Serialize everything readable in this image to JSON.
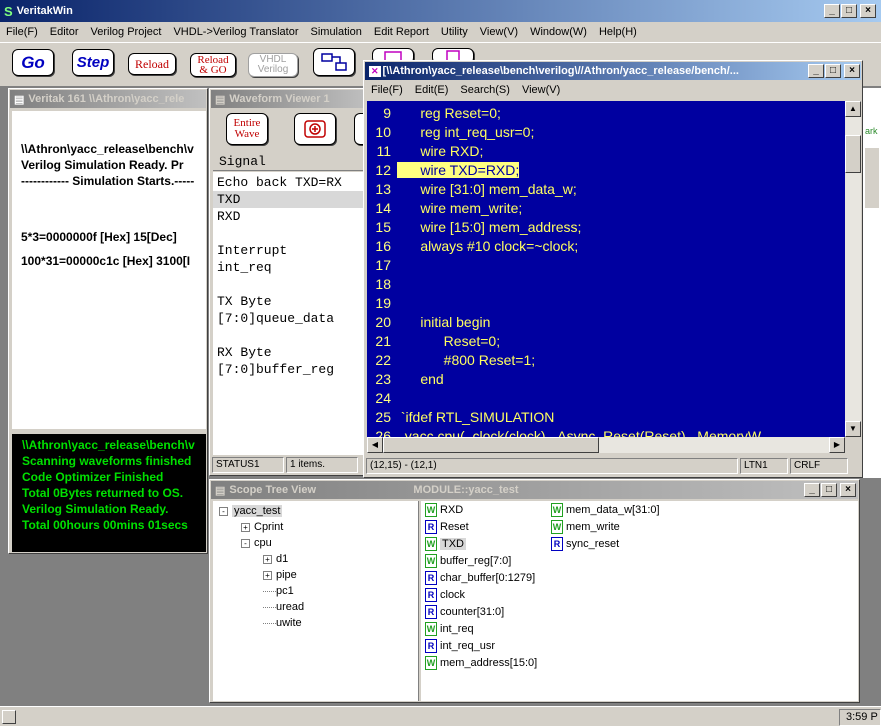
{
  "app": {
    "title": "VeritakWin"
  },
  "menu": [
    "File(F)",
    "Editor",
    "Verilog Project",
    "VHDL->Verilog Translator",
    "Simulation",
    "Edit Report",
    "Utility",
    "View(V)",
    "Window(W)",
    "Help(H)"
  ],
  "toolbar": {
    "go": "Go",
    "step": "Step",
    "reload": "Reload",
    "reload_go_1": "Reload",
    "reload_go_2": "& GO",
    "vhdl_1": "VHDL",
    "vhdl_2": "Verilog"
  },
  "console": {
    "title": "Veritak 161 \\\\Athron\\yacc_rele",
    "lines": [
      "\\\\Athron\\yacc_release\\bench\\v",
      "Verilog Simulation Ready. Pr",
      "------------ Simulation Starts.-----",
      "",
      "",
      "5*3=0000000f [Hex]    15[Dec]",
      "",
      "100*31=00000c1c [Hex]   3100[I"
    ],
    "green_lines": [
      "\\\\Athron\\yacc_release\\bench\\v",
      "Scanning waveforms finished",
      "Code Optimizer Finished",
      "Total 0Bytes returned to OS.",
      "Verilog Simulation Ready.",
      "Total  00hours 00mins 01secs"
    ]
  },
  "waveform": {
    "title": "Waveform Viewer 1",
    "entire_wave_1": "Entire",
    "entire_wave_2": "Wave",
    "signal_header": "Signal",
    "signals": [
      "Echo back TXD=RX",
      "TXD",
      "RXD",
      "",
      "Interrupt",
      "int_req",
      "",
      "TX Byte",
      "[7:0]queue_data",
      "",
      "RX Byte",
      "[7:0]buffer_reg"
    ],
    "status": [
      "STATUS1",
      "1 items."
    ]
  },
  "editor": {
    "title": "[\\\\Athron\\yacc_release\\bench\\verilog\\//Athron/yacc_release/bench/...",
    "menu": [
      "File(F)",
      "Edit(E)",
      "Search(S)",
      "View(V)"
    ],
    "lines": [
      {
        "n": "9",
        "t": "      reg Reset=0;"
      },
      {
        "n": "10",
        "t": "      reg int_req_usr=0;"
      },
      {
        "n": "11",
        "t": "      wire RXD;"
      },
      {
        "n": "12",
        "t": "      wire TXD=RXD;"
      },
      {
        "n": "13",
        "t": "      wire [31:0] mem_data_w;"
      },
      {
        "n": "14",
        "t": "      wire mem_write;"
      },
      {
        "n": "15",
        "t": "      wire [15:0] mem_address;"
      },
      {
        "n": "16",
        "t": "      always #10 clock=~clock;"
      },
      {
        "n": "17",
        "t": ""
      },
      {
        "n": "18",
        "t": ""
      },
      {
        "n": "19",
        "t": ""
      },
      {
        "n": "20",
        "t": "      initial begin"
      },
      {
        "n": "21",
        "t": "            Reset=0;"
      },
      {
        "n": "22",
        "t": "            #800 Reset=1;"
      },
      {
        "n": "23",
        "t": "      end"
      },
      {
        "n": "24",
        "t": ""
      },
      {
        "n": "25",
        "t": " `ifdef RTL_SIMULATION"
      },
      {
        "n": "26",
        "t": "  yacc cpu( .clock(clock), .Async_Reset(Reset), .MemoryW"
      }
    ],
    "highlight_line": "12",
    "status": [
      "(12,15) - (12,1)",
      "LTN1",
      "CRLF"
    ]
  },
  "scope": {
    "title": "Scope Tree View",
    "module": "MODULE::yacc_test",
    "tree": [
      {
        "label": "yacc_test",
        "indent": 0,
        "expander": "-"
      },
      {
        "label": "Cprint",
        "indent": 1,
        "expander": "+"
      },
      {
        "label": "cpu",
        "indent": 1,
        "expander": "-"
      },
      {
        "label": "d1",
        "indent": 2,
        "expander": "+"
      },
      {
        "label": "pipe",
        "indent": 2,
        "expander": "+"
      },
      {
        "label": "pc1",
        "indent": 2,
        "expander": ""
      },
      {
        "label": "uread",
        "indent": 2,
        "expander": ""
      },
      {
        "label": "uwite",
        "indent": 2,
        "expander": ""
      }
    ],
    "vars_col1": [
      {
        "kind": "W",
        "name": "RXD"
      },
      {
        "kind": "R",
        "name": "Reset"
      },
      {
        "kind": "W",
        "name": "TXD"
      },
      {
        "kind": "W",
        "name": "buffer_reg[7:0]"
      },
      {
        "kind": "R",
        "name": "char_buffer[0:1279]"
      },
      {
        "kind": "R",
        "name": "clock"
      },
      {
        "kind": "R",
        "name": "counter[31:0]"
      },
      {
        "kind": "W",
        "name": "int_req"
      },
      {
        "kind": "R",
        "name": "int_req_usr"
      },
      {
        "kind": "W",
        "name": "mem_address[15:0]"
      }
    ],
    "vars_col2": [
      {
        "kind": "W",
        "name": "mem_data_w[31:0]"
      },
      {
        "kind": "W",
        "name": "mem_write"
      },
      {
        "kind": "R",
        "name": "sync_reset"
      }
    ]
  },
  "taskbar": {
    "clock": "3:59 P"
  },
  "right_partial": "ark"
}
